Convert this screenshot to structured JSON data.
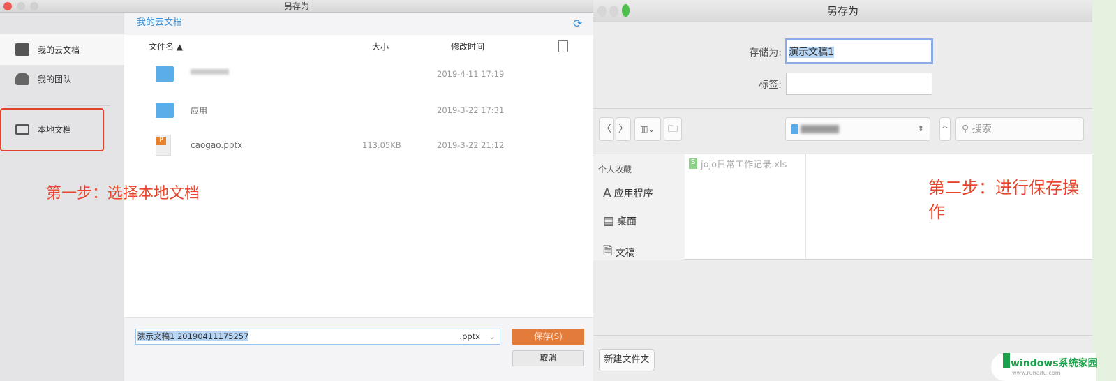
{
  "left_dialog": {
    "title": "另存为",
    "sidebar": [
      {
        "label": "我的云文档",
        "icon": "cloud-folder-icon"
      },
      {
        "label": "我的团队",
        "icon": "team-icon"
      },
      {
        "label": "本地文档",
        "icon": "monitor-icon"
      }
    ],
    "breadcrumb": "我的云文档",
    "columns": {
      "name": "文件名 ▲",
      "size": "大小",
      "modified": "修改时间"
    },
    "files": [
      {
        "name": "",
        "type": "folder",
        "size": "",
        "modified": "2019-4-11 17:19"
      },
      {
        "name": "应用",
        "type": "folder",
        "size": "",
        "modified": "2019-3-22 17:31"
      },
      {
        "name": "caogao.pptx",
        "type": "pptx",
        "size": "113.05KB",
        "modified": "2019-3-22 21:12"
      }
    ],
    "filename_value": "演示文稿1 20190411175257",
    "extension": ".pptx",
    "save_label": "保存(S)",
    "cancel_label": "取消",
    "annotation": "第一步：选择本地文档",
    "highlight_color": "#e8452c"
  },
  "right_dialog": {
    "title": "另存为",
    "save_as_label": "存储为:",
    "save_as_value": "演示文稿1",
    "tags_label": "标签:",
    "tags_value": "",
    "search_placeholder": "搜索",
    "favorites_header": "个人收藏",
    "favorites": [
      {
        "label": "应用程序",
        "icon": "applications-icon"
      },
      {
        "label": "桌面",
        "icon": "desktop-icon"
      },
      {
        "label": "文稿",
        "icon": "documents-icon"
      }
    ],
    "files": [
      {
        "name": "jojo日常工作记录.xls",
        "icon": "spreadsheet-icon"
      }
    ],
    "new_folder_label": "新建文件夹",
    "annotation": "第二步：进行保存操作"
  },
  "watermark": {
    "text": "windows系统家园",
    "url_text": "www.ruhaifu.com"
  }
}
